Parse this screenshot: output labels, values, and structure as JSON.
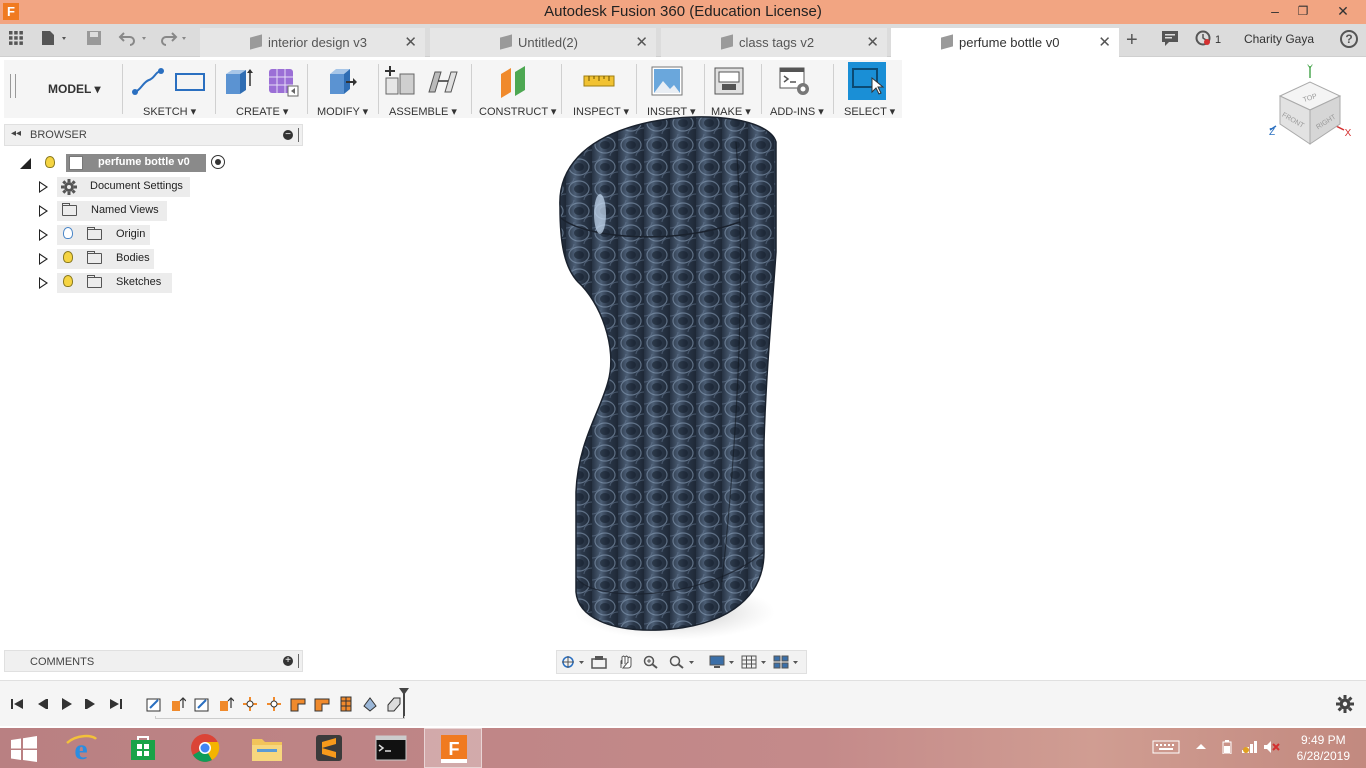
{
  "window": {
    "title": "Autodesk Fusion 360 (Education License)",
    "app_logo": "F",
    "minimize": "–",
    "maximize": "❐",
    "close": "✕"
  },
  "tabs": [
    {
      "label": "interior design v3",
      "close": "✕"
    },
    {
      "label": "Untitled(2)",
      "close": "✕"
    },
    {
      "label": "class tags v2",
      "close": "✕"
    },
    {
      "label": "perfume bottle v0",
      "close": "✕"
    }
  ],
  "header": {
    "new_tab": "+",
    "jobs_count": "1",
    "user": "Charity Gaya",
    "help": "?"
  },
  "ribbon": {
    "workspace": "MODEL ▾",
    "groups": [
      "SKETCH ▾",
      "CREATE ▾",
      "MODIFY ▾",
      "ASSEMBLE ▾",
      "CONSTRUCT ▾",
      "INSPECT ▾",
      "INSERT ▾",
      "MAKE ▾",
      "ADD-INS ▾",
      "SELECT ▾"
    ]
  },
  "browser": {
    "title": "BROWSER",
    "collapse": "◂◂",
    "minimize": "−",
    "root": "perfume bottle v0",
    "items": [
      {
        "label": "Document Settings",
        "icon": "gear-icon"
      },
      {
        "label": "Named Views",
        "icon": "folder-icon"
      },
      {
        "label": "Origin",
        "icon": "folder-icon"
      },
      {
        "label": "Bodies",
        "icon": "folder-icon"
      },
      {
        "label": "Sketches",
        "icon": "folder-icon"
      }
    ]
  },
  "comments": {
    "title": "COMMENTS",
    "add": "+"
  },
  "viewcube": {
    "top": "TOP",
    "front": "FRONT",
    "right": "RIGHT",
    "x": "X",
    "y": "Y",
    "z": "Z"
  },
  "taskbar": {
    "time": "9:49 PM",
    "date": "6/28/2019"
  },
  "colors": {
    "titlebar": "#f2a582",
    "select_active": "#1a8fd6",
    "taskbar": "#c48a8a",
    "body_dark": "#2d3a4d",
    "body_light": "#6c7f96"
  }
}
